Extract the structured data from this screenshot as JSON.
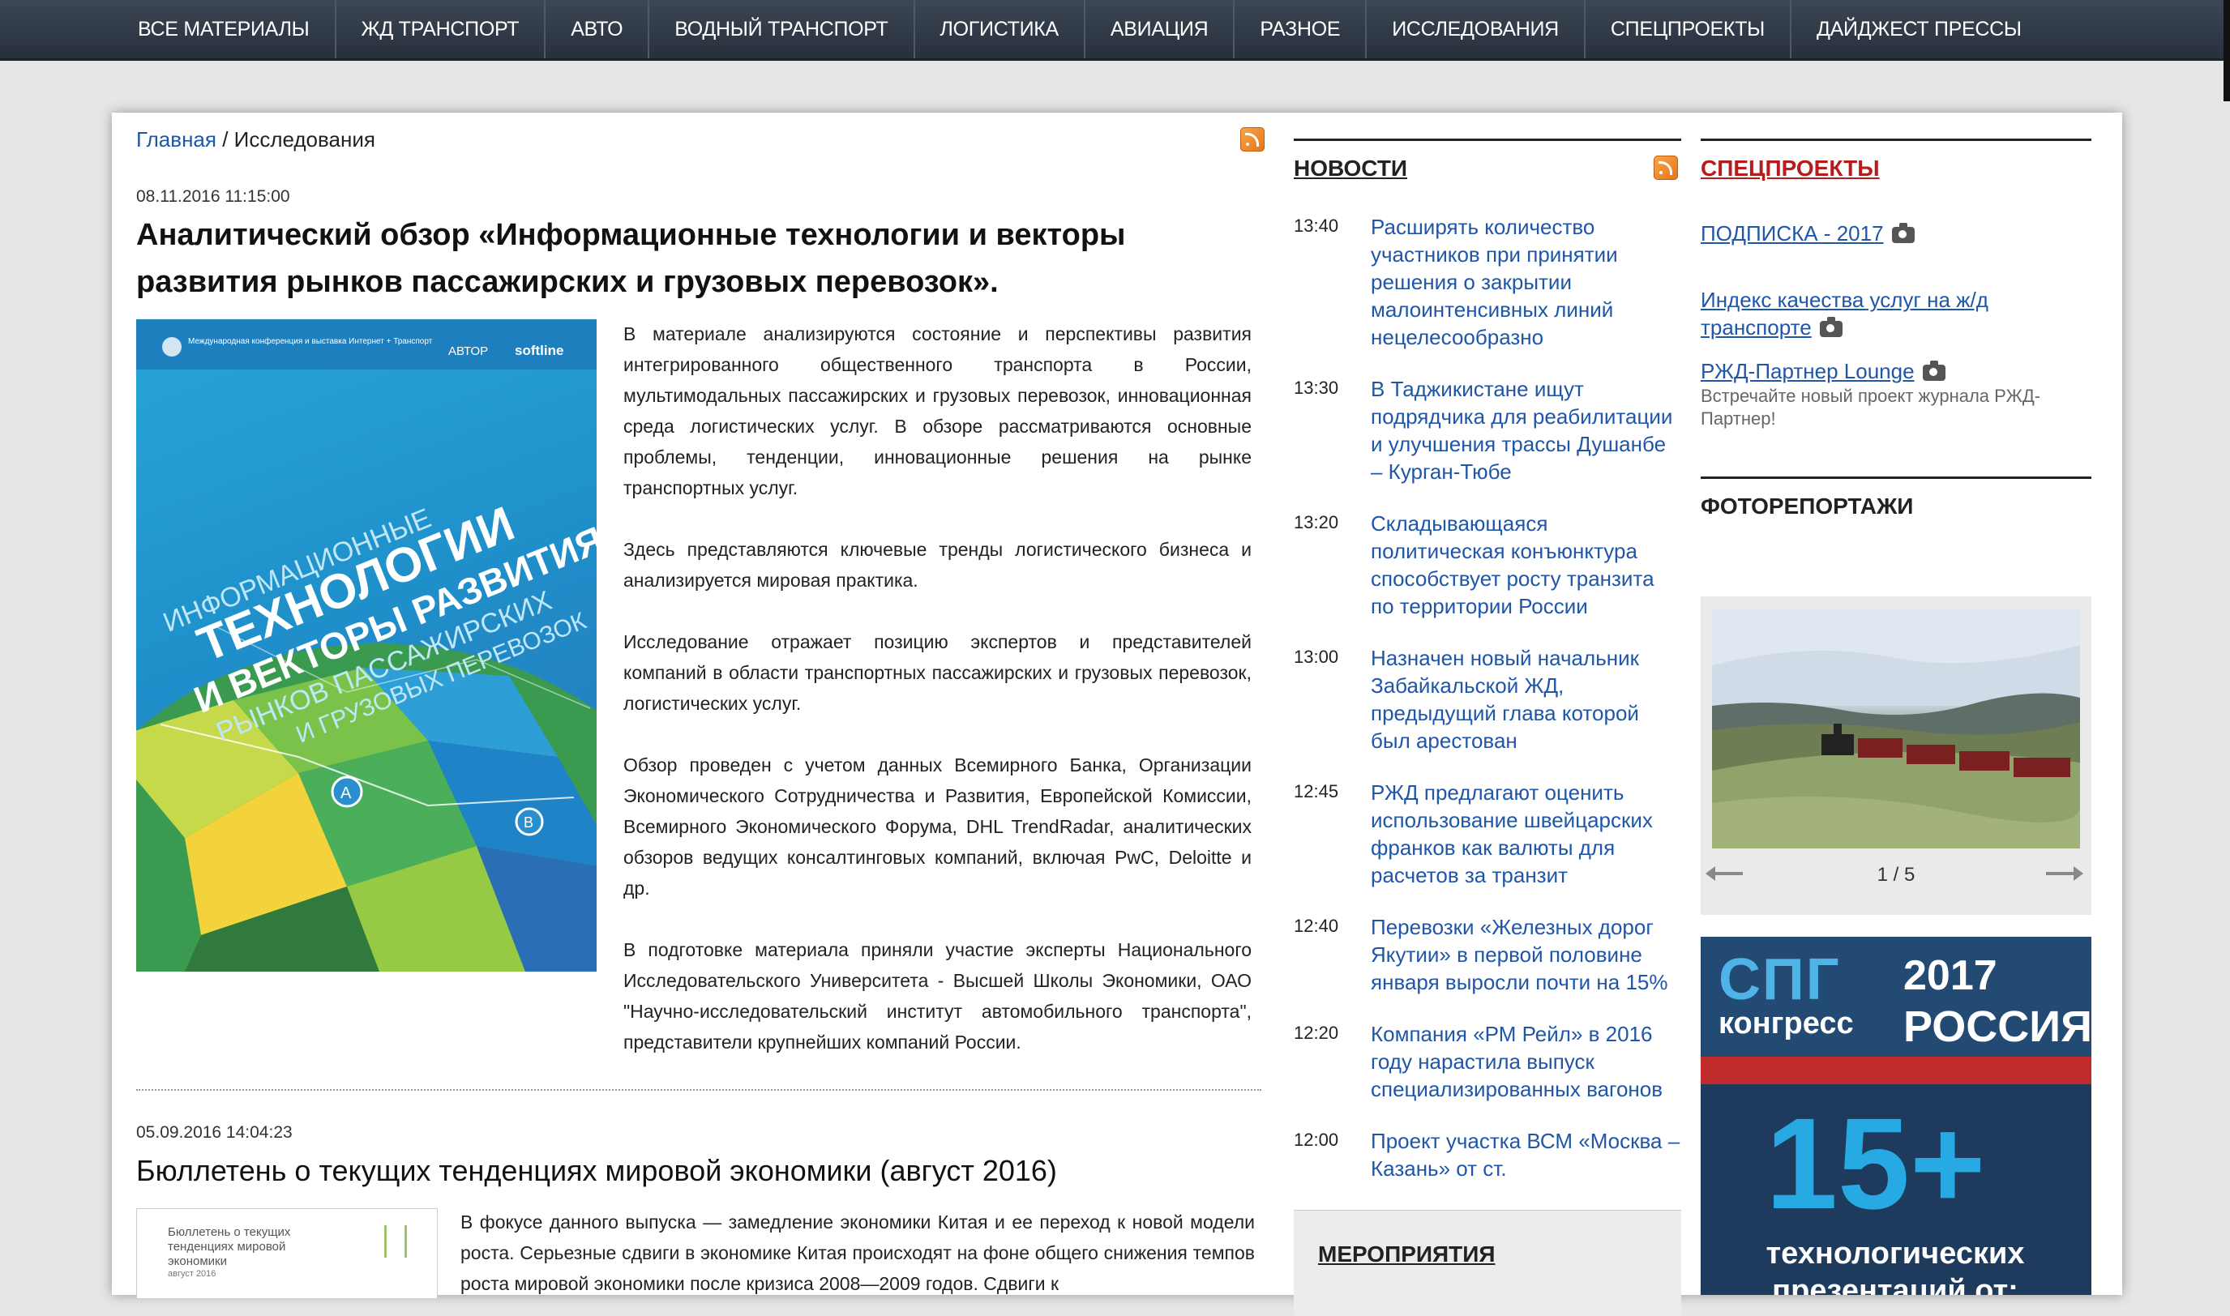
{
  "topnav": {
    "items": [
      "ВСЕ МАТЕРИАЛЫ",
      "ЖД ТРАНСПОРТ",
      "АВТО",
      "ВОДНЫЙ ТРАНСПОРТ",
      "ЛОГИСТИКА",
      "АВИАЦИЯ",
      "РАЗНОЕ",
      "ИССЛЕДОВАНИЯ",
      "СПЕЦПРОЕКТЫ",
      "ДАЙДЖЕСТ ПРЕССЫ"
    ]
  },
  "breadcrumb": {
    "home": "Главная",
    "separator": " / ",
    "current": "Исследования"
  },
  "article1": {
    "date": "08.11.2016 11:15:00",
    "title": "Аналитический обзор «Информационные технологии и векторы развития рынков пассажирских и грузовых перевозок».",
    "cover": {
      "line1": "ИНФОРМАЦИОННЫЕ",
      "line2": "ТЕХНОЛОГИИ",
      "line3": "И ВЕКТОРЫ РАЗВИТИЯ",
      "line4": "РЫНКОВ ПАССАЖИРСКИХ",
      "line5": "И ГРУЗОВЫХ ПЕРЕВОЗОК",
      "logo_avtor": "АВТОР",
      "logo_softline": "softline",
      "logo_conf": "Международная конференция и выставка Интернет + Транспорт",
      "pin_a": "A",
      "pin_b": "B"
    },
    "paragraphs": [
      "В материале анализируются состояние и перспективы развития интегрированного общественного транспорта в России, мультимодальных пассажирских и грузовых перевозок, инновационная среда логистических услуг. В обзоре рассматриваются основные проблемы, тенденции, инновационные решения на рынке транспортных услуг.",
      "Здесь представляются ключевые тренды логистического бизнеса и анализируется мировая практика.",
      "Исследование отражает позицию экспертов и представителей компаний в области транспортных пассажирских и грузовых перевозок, логистических услуг.",
      "Обзор проведен с учетом данных Всемирного Банка, Организации Экономического Сотрудничества и Развития, Европейской Комиссии, Всемирного Экономического Форума, DHL TrendRadar, аналитических обзоров ведущих консалтинговых компаний, включая PwC, Deloitte и др.",
      "В подготовке материала приняли участие эксперты Национального Исследовательского Университета - Высшей Школы Экономики, ОАО \"Научно-исследовательский институт автомобильного транспорта\", представители крупнейших компаний России."
    ]
  },
  "article2": {
    "date": "05.09.2016 14:04:23",
    "title": "Бюллетень о текущих тенденциях мировой экономики (август 2016)",
    "thumb_title": "Бюллетень о текущих тенденциях мировой экономики",
    "thumb_sub": "август 2016",
    "body": "В фокусе данного выпуска — замедление экономики Китая и ее переход к новой модели роста. Серьезные сдвиги в экономике Китая происходят на фоне общего снижения темпов роста мировой экономики после кризиса 2008—2009 годов. Сдвиги к"
  },
  "news": {
    "heading": "НОВОСТИ",
    "items": [
      {
        "time": "13:40",
        "text": "Расширять количество участников при принятии решения о закрытии малоинтенсивных линий нецелесообразно"
      },
      {
        "time": "13:30",
        "text": "В Таджикистане ищут подрядчика для реабилитации и улучшения трассы Душанбе – Курган-Тюбе"
      },
      {
        "time": "13:20",
        "text": "Складывающаяся политическая конъюнктура способствует росту транзита по территории России"
      },
      {
        "time": "13:00",
        "text": "Назначен новый начальник Забайкальской ЖД, предыдущий глава которой был арестован"
      },
      {
        "time": "12:45",
        "text": "РЖД предлагают оценить использование швейцарских франков как валюты для расчетов за транзит"
      },
      {
        "time": "12:40",
        "text": "Перевозки «Железных дорог Якутии» в первой половине января выросли почти на 15%"
      },
      {
        "time": "12:20",
        "text": "Компания «РМ Рейл» в 2016 году нарастила выпуск специализированных вагонов"
      },
      {
        "time": "12:00",
        "text": "Проект участка ВСМ «Москва – Казань» от ст."
      }
    ]
  },
  "events": {
    "heading": "МЕРОПРИЯТИЯ"
  },
  "specprojects": {
    "heading": "СПЕЦПРОЕКТЫ",
    "items": [
      {
        "text": "ПОДПИСКА - 2017",
        "desc": ""
      },
      {
        "text": "Индекс качества услуг на ж/д транспорте",
        "desc": ""
      },
      {
        "text": "РЖД-Партнер Lounge",
        "desc": "Встречайте новый проект журнала РЖД-Партнер!"
      }
    ]
  },
  "photoreports": {
    "heading": "ФОТОРЕПОРТАЖИ",
    "pager": "1 / 5"
  },
  "banner": {
    "spg": "СПГ",
    "year": "2017",
    "kongress": "конгресс",
    "russia": "РОССИЯ",
    "big": "15+",
    "line1": "технологических",
    "line2": "презентаций от:"
  },
  "colors": {
    "nav_bg": "#2f3845",
    "link": "#1f56a8",
    "spec_heading": "#b51d1d",
    "rss": "#f08a24"
  }
}
